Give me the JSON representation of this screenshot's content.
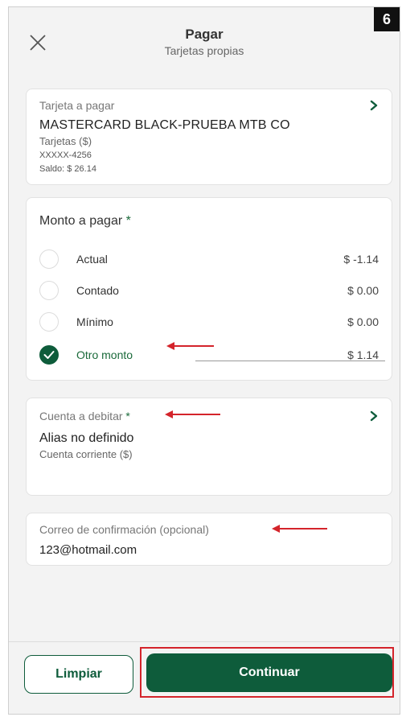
{
  "step_badge": "6",
  "header": {
    "title": "Pagar",
    "subtitle": "Tarjetas propias",
    "close_icon": "close-icon"
  },
  "tarjeta": {
    "label": "Tarjeta a pagar",
    "name": "MASTERCARD BLACK-PRUEBA MTB CO",
    "type": "Tarjetas ($)",
    "number": "XXXXX-4256",
    "saldo": "Saldo: $ 26.14"
  },
  "monto": {
    "title": "Monto a pagar",
    "required_mark": "*",
    "options": [
      {
        "label": "Actual",
        "value": "$ -1.14",
        "selected": false
      },
      {
        "label": "Contado",
        "value": "$ 0.00",
        "selected": false
      },
      {
        "label": "Mínimo",
        "value": "$ 0.00",
        "selected": false
      },
      {
        "label": "Otro monto",
        "value": "$ 1.14",
        "selected": true
      }
    ]
  },
  "cuenta": {
    "label": "Cuenta a debitar",
    "required_mark": "*",
    "alias": "Alias no definido",
    "type": "Cuenta corriente ($)"
  },
  "correo": {
    "label": "Correo de confirmación (opcional)",
    "value": "123@hotmail.com"
  },
  "footer": {
    "limpiar_label": "Limpiar",
    "continuar_label": "Continuar"
  },
  "colors": {
    "brand_green": "#0e5c3b",
    "annotation_red": "#d4242b"
  }
}
